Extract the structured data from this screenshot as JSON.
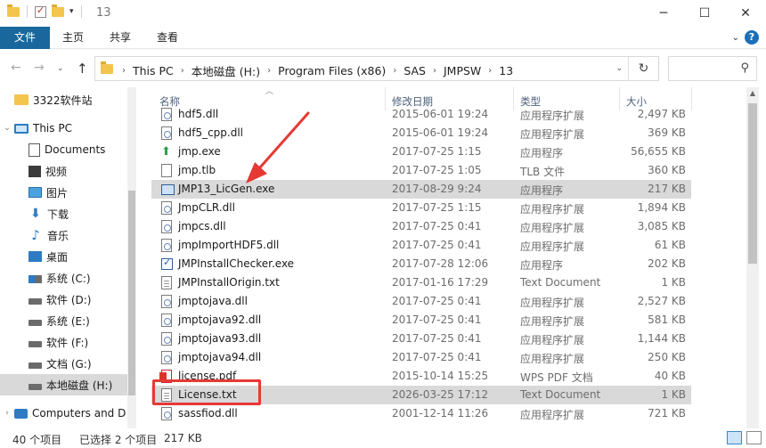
{
  "window": {
    "title": "13"
  },
  "ribbon": {
    "tabs": [
      "文件",
      "主页",
      "共享",
      "查看"
    ]
  },
  "address": {
    "crumbs": [
      "This PC",
      "本地磁盘 (H:)",
      "Program Files (x86)",
      "SAS",
      "JMPSW",
      "13"
    ]
  },
  "nav": {
    "items": [
      {
        "label": "3322软件站",
        "icon": "folder-icon"
      },
      {
        "label": "This PC",
        "icon": "computer-icon"
      },
      {
        "label": "Documents",
        "icon": "documents-icon"
      },
      {
        "label": "视频",
        "icon": "video-icon"
      },
      {
        "label": "图片",
        "icon": "picture-icon"
      },
      {
        "label": "下载",
        "icon": "download-icon"
      },
      {
        "label": "音乐",
        "icon": "music-icon"
      },
      {
        "label": "桌面",
        "icon": "desktop-icon"
      },
      {
        "label": "系统 (C:)",
        "icon": "drive-icon"
      },
      {
        "label": "软件 (D:)",
        "icon": "drive-icon"
      },
      {
        "label": "系统 (E:)",
        "icon": "drive-icon"
      },
      {
        "label": "软件 (F:)",
        "icon": "drive-icon"
      },
      {
        "label": "文档 (G:)",
        "icon": "drive-icon"
      },
      {
        "label": "本地磁盘 (H:)",
        "icon": "drive-icon"
      },
      {
        "label": "Computers and D",
        "icon": "network-icon"
      }
    ]
  },
  "columns": {
    "name": "名称",
    "date": "修改日期",
    "type": "类型",
    "size": "大小"
  },
  "files": [
    {
      "name": "hdf5.dll",
      "date": "2015-06-01 19:24",
      "type": "应用程序扩展",
      "size": "2,497 KB",
      "icon": "dll"
    },
    {
      "name": "hdf5_cpp.dll",
      "date": "2015-06-01 19:24",
      "type": "应用程序扩展",
      "size": "369 KB",
      "icon": "dll"
    },
    {
      "name": "jmp.exe",
      "date": "2017-07-25 1:15",
      "type": "应用程序",
      "size": "56,655 KB",
      "icon": "exe-green"
    },
    {
      "name": "jmp.tlb",
      "date": "2017-07-25 1:05",
      "type": "TLB 文件",
      "size": "360 KB",
      "icon": "file"
    },
    {
      "name": "JMP13_LicGen.exe",
      "date": "2017-08-29 9:24",
      "type": "应用程序",
      "size": "217 KB",
      "icon": "exe-app",
      "selected": true
    },
    {
      "name": "JmpCLR.dll",
      "date": "2017-07-25 1:15",
      "type": "应用程序扩展",
      "size": "1,894 KB",
      "icon": "dll"
    },
    {
      "name": "jmpcs.dll",
      "date": "2017-07-25 0:41",
      "type": "应用程序扩展",
      "size": "3,085 KB",
      "icon": "dll"
    },
    {
      "name": "jmpImportHDF5.dll",
      "date": "2017-07-25 0:41",
      "type": "应用程序扩展",
      "size": "61 KB",
      "icon": "dll"
    },
    {
      "name": "JMPInstallChecker.exe",
      "date": "2017-07-28 12:06",
      "type": "应用程序",
      "size": "202 KB",
      "icon": "exe-check"
    },
    {
      "name": "JMPInstallOrigin.txt",
      "date": "2017-01-16 17:29",
      "type": "Text Document",
      "size": "1 KB",
      "icon": "txt"
    },
    {
      "name": "jmptojava.dll",
      "date": "2017-07-25 0:41",
      "type": "应用程序扩展",
      "size": "2,527 KB",
      "icon": "dll"
    },
    {
      "name": "jmptojava92.dll",
      "date": "2017-07-25 0:41",
      "type": "应用程序扩展",
      "size": "581 KB",
      "icon": "dll"
    },
    {
      "name": "jmptojava93.dll",
      "date": "2017-07-25 0:41",
      "type": "应用程序扩展",
      "size": "1,144 KB",
      "icon": "dll"
    },
    {
      "name": "jmptojava94.dll",
      "date": "2017-07-25 0:41",
      "type": "应用程序扩展",
      "size": "250 KB",
      "icon": "dll"
    },
    {
      "name": "license.pdf",
      "date": "2015-10-14 15:25",
      "type": "WPS PDF 文档",
      "size": "40 KB",
      "icon": "pdf"
    },
    {
      "name": "License.txt",
      "date": "2026-03-25 17:12",
      "type": "Text Document",
      "size": "1 KB",
      "icon": "txt",
      "selected": true
    },
    {
      "name": "sassfiod.dll",
      "date": "2001-12-14 11:26",
      "type": "应用程序扩展",
      "size": "721 KB",
      "icon": "dll"
    }
  ],
  "status": {
    "count": "40 个项目",
    "selected": "已选择 2 个项目",
    "size": "217 KB"
  },
  "colors": {
    "file_tab": "#19679c",
    "selection": "#d9d9d9",
    "annotation": "#e53935"
  }
}
